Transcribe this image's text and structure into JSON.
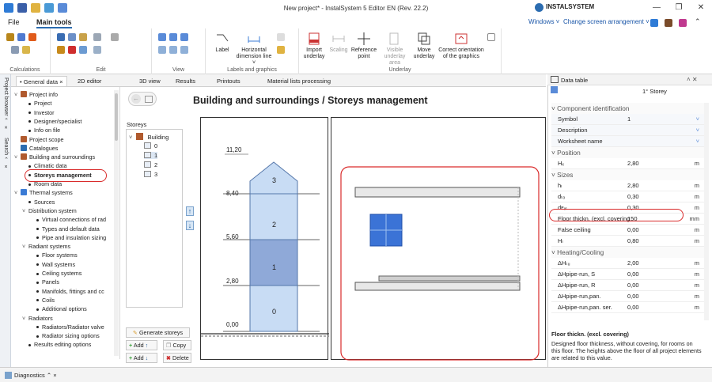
{
  "window": {
    "title": "New project* - InstalSystem 5 Editor EN (Rev. 22.2)",
    "brand": "INSTALSYSTEM",
    "controls": [
      "minimize",
      "restore",
      "close"
    ]
  },
  "menubar": {
    "items": [
      "File",
      "Main tools"
    ],
    "windows_label": "Windows ˅",
    "arrangement_label": "Change screen arrangement ˅"
  },
  "ribbon": {
    "groups": [
      "Calculations",
      "Edit",
      "View",
      "Labels and graphics",
      "Underlay"
    ],
    "buttons": {
      "label": "Label",
      "horizontal_dim": "Horizontal dimension line ˅",
      "import_underlay": "Import underlay",
      "scaling": "Scaling",
      "reference_point": "Reference point",
      "visible_underlay": "Visible underlay area",
      "move_underlay": "Move underlay",
      "correct_orientation": "Correct orientation of the graphics"
    }
  },
  "sidebar": {
    "project_browser": "Project browser ⌃ ×",
    "search": "Search ⌃ ×"
  },
  "tabs": [
    {
      "label": "• General data ×",
      "active": true
    },
    {
      "label": "2D editor"
    },
    {
      "label": "3D view"
    },
    {
      "label": "Results"
    },
    {
      "label": "Printouts"
    },
    {
      "label": "Material lists processing"
    }
  ],
  "tree": [
    {
      "label": "Project info",
      "level": 0,
      "caret": "˅"
    },
    {
      "label": "Project",
      "level": 1
    },
    {
      "label": "Investor",
      "level": 1
    },
    {
      "label": "Designer/specialist",
      "level": 1
    },
    {
      "label": "Info on file",
      "level": 1
    },
    {
      "label": "Project scope",
      "level": 0
    },
    {
      "label": "Catalogues",
      "level": 0
    },
    {
      "label": "Building and surroundings",
      "level": 0,
      "caret": "˅"
    },
    {
      "label": "Climatic data",
      "level": 1
    },
    {
      "label": "Storeys management",
      "level": 1,
      "selected": true
    },
    {
      "label": "Room data",
      "level": 1
    },
    {
      "label": "Thermal systems",
      "level": 0,
      "caret": "˅"
    },
    {
      "label": "Sources",
      "level": 1
    },
    {
      "label": "Distribution system",
      "level": 1,
      "caret": "˅"
    },
    {
      "label": "Virtual connections of rad",
      "level": 2
    },
    {
      "label": "Types and default data",
      "level": 2
    },
    {
      "label": "Pipe and insulation sizing",
      "level": 2
    },
    {
      "label": "Radiant systems",
      "level": 1,
      "caret": "˅"
    },
    {
      "label": "Floor systems",
      "level": 2
    },
    {
      "label": "Wall systems",
      "level": 2
    },
    {
      "label": "Ceiling systems",
      "level": 2
    },
    {
      "label": "Panels",
      "level": 2
    },
    {
      "label": "Manifolds, fittings and cc",
      "level": 2
    },
    {
      "label": "Coils",
      "level": 2
    },
    {
      "label": "Additional options",
      "level": 2
    },
    {
      "label": "Radiators",
      "level": 1,
      "caret": "˅"
    },
    {
      "label": "Radiators/Radiator valve",
      "level": 2
    },
    {
      "label": "Radiator sizing options",
      "level": 2
    },
    {
      "label": "Results editing options",
      "level": 1
    }
  ],
  "page": {
    "title": "Building and surroundings / Storeys management",
    "storeys_label": "Storeys",
    "building_label": "Building",
    "storeys": [
      "0",
      "1",
      "2",
      "3"
    ],
    "buttons": {
      "generate": "Generate storeys",
      "add_up": "Add",
      "copy": "Copy",
      "add_down": "Add",
      "delete": "Delete"
    },
    "levels": [
      "11,20",
      "8,40",
      "5,60",
      "2,80",
      "0,00"
    ],
    "storey_numbers": [
      "3",
      "2",
      "1",
      "0"
    ]
  },
  "data_table": {
    "title": "Data table",
    "storey": "1° Storey",
    "sections": [
      "Component identification",
      "Position",
      "Sizes",
      "Heating/Cooling"
    ],
    "identification": [
      {
        "key": "Symbol",
        "value": "1"
      },
      {
        "key": "Description",
        "value": ""
      },
      {
        "key": "Worksheet name",
        "value": ""
      }
    ],
    "position": [
      {
        "key": "Hₓ",
        "value": "2,80",
        "unit": "m"
      }
    ],
    "sizes": [
      {
        "key": "hₗ",
        "value": "2,80",
        "unit": "m"
      },
      {
        "key": "dₜₒ",
        "value": "0,30",
        "unit": "m"
      },
      {
        "key": "dᴇₓₗ",
        "value": "0,30",
        "unit": "m"
      },
      {
        "key": "Floor thickn. (excl. covering",
        "value": "150",
        "unit": "mm"
      },
      {
        "key": "False ceiling",
        "value": "0,00",
        "unit": "m"
      },
      {
        "key": "Hₗ",
        "value": "0,80",
        "unit": "m"
      }
    ],
    "heating": [
      {
        "key": "ΔHₜᵤ",
        "value": "2,00",
        "unit": "m"
      },
      {
        "key": "ΔHpipe-run, S",
        "value": "0,00",
        "unit": "m"
      },
      {
        "key": "ΔHpipe-run, R",
        "value": "0,00",
        "unit": "m"
      },
      {
        "key": "ΔHpipe-run,pan.",
        "value": "0,00",
        "unit": "m"
      },
      {
        "key": "ΔHpipe-run,pan. ser.",
        "value": "0,00",
        "unit": "m"
      }
    ],
    "help_title": "Floor thickn. (excl. covering)",
    "help_text": "Designed floor thickness, without covering, for rooms on this floor. The heights above the floor of all project elements are related to this value."
  },
  "statusbar": {
    "diagnostics": "Diagnostics ⌃ ×"
  }
}
